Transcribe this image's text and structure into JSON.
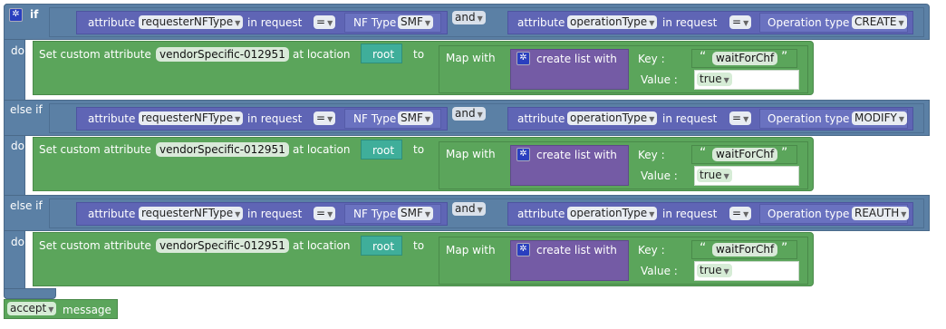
{
  "keywords": {
    "if": "if",
    "else_if": "else if",
    "do": "do",
    "and": "and",
    "attribute": "attribute",
    "in_request": "in request",
    "nf_type": "NF Type",
    "operation_type": "Operation type",
    "set_custom_attribute": "Set custom attribute",
    "at_location": "at location",
    "to": "to",
    "map_with": "Map with",
    "create_list_with": "create list with",
    "key": "Key :",
    "value": "Value :",
    "message": "message",
    "quote_open": "“",
    "quote_close": "”"
  },
  "conditions": [
    {
      "attr1": "requesterNFType",
      "op1": "=",
      "nf_type": "SMF",
      "and": "and",
      "attr2": "operationType",
      "op2": "=",
      "operation_type": "CREATE"
    },
    {
      "attr1": "requesterNFType",
      "op1": "=",
      "nf_type": "SMF",
      "and": "and",
      "attr2": "operationType",
      "op2": "=",
      "operation_type": "MODIFY"
    },
    {
      "attr1": "requesterNFType",
      "op1": "=",
      "nf_type": "SMF",
      "and": "and",
      "attr2": "operationType",
      "op2": "=",
      "operation_type": "REAUTH"
    }
  ],
  "actions": [
    {
      "attribute_name": "vendorSpecific-012951",
      "location": "root",
      "key": "waitForChf",
      "value": "true"
    },
    {
      "attribute_name": "vendorSpecific-012951",
      "location": "root",
      "key": "waitForChf",
      "value": "true"
    },
    {
      "attribute_name": "vendorSpecific-012951",
      "location": "root",
      "key": "waitForChf",
      "value": "true"
    }
  ],
  "final": {
    "decision": "accept"
  },
  "colors": {
    "logic_blue": "#5b80a5",
    "action_green": "#5ba55b",
    "list_purple": "#745ba5",
    "location_teal": "#3fae9a"
  }
}
